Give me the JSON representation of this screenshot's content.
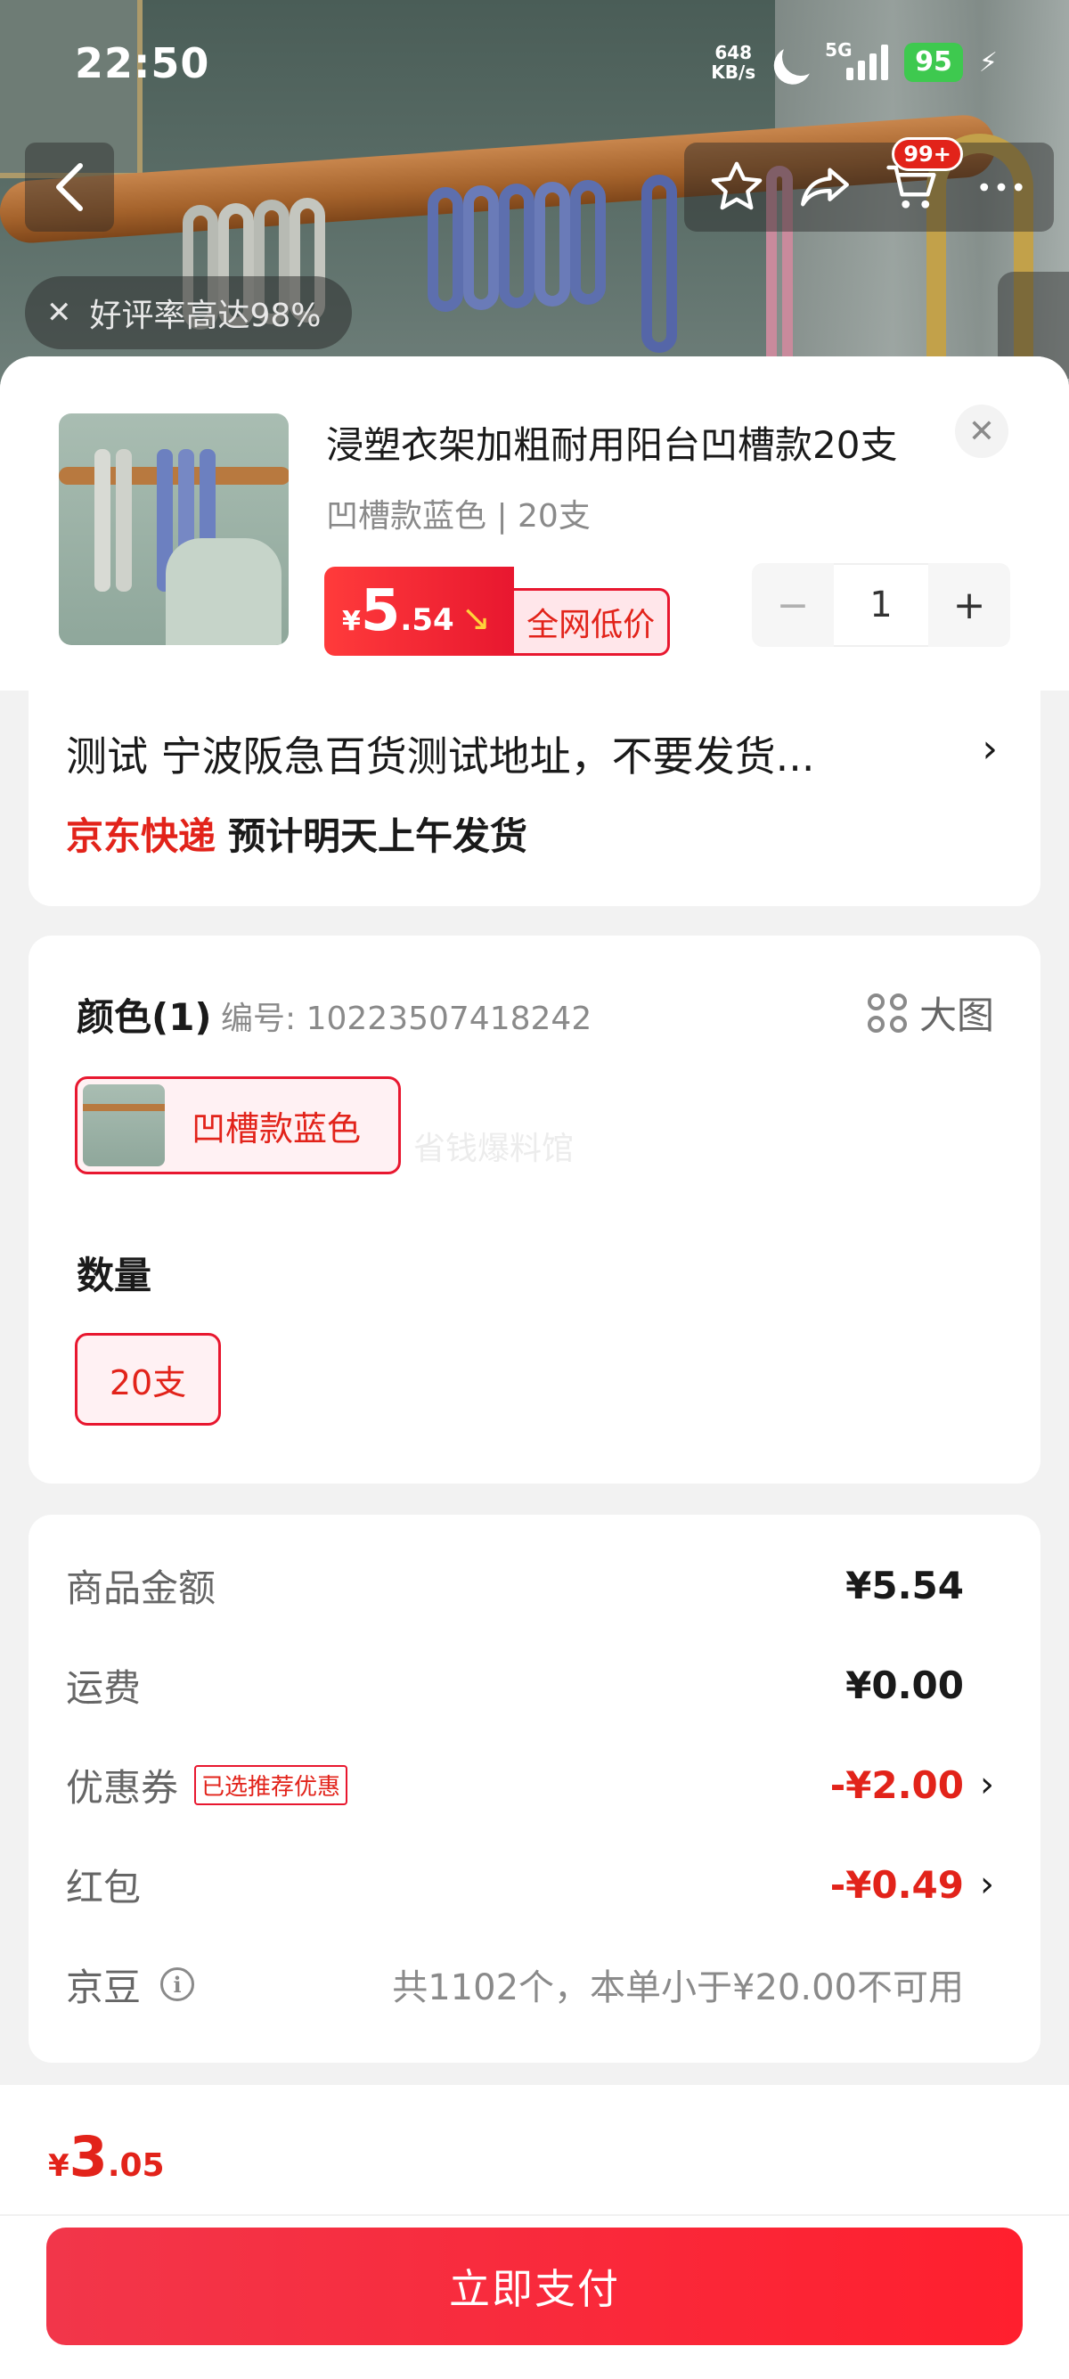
{
  "status_bar": {
    "time": "22:50",
    "net_speed_value": "648",
    "net_speed_unit": "KB/s",
    "network": "5G",
    "battery": "95"
  },
  "nav": {
    "cart_badge": "99+"
  },
  "rating_chip": {
    "text": "好评率高达98%"
  },
  "product": {
    "title": "浸塑衣架加粗耐用阳台凹槽款20支",
    "spec": "凹槽款蓝色 | 20支",
    "price_currency": "¥",
    "price_int": "5",
    "price_dec": ".54",
    "price_label": "全网低价",
    "quantity": "1"
  },
  "address": {
    "text": "测试  宁波阪急百货测试地址，不要发货...",
    "carrier": "京东快递",
    "eta": "预计明天上午发货"
  },
  "spec_panel": {
    "color_title": "颜色(1)",
    "sku": "编号: 10223507418242",
    "big_image": "大图",
    "color_option": "凹槽款蓝色",
    "watermark": "省钱爆料馆",
    "quantity_title": "数量",
    "quantity_option": "20支"
  },
  "costs": {
    "goods_label": "商品金额",
    "goods_value": "¥5.54",
    "shipping_label": "运费",
    "shipping_value": "¥0.00",
    "coupon_label": "优惠券",
    "coupon_tag": "已选推荐优惠",
    "coupon_value": "-¥2.00",
    "redpacket_label": "红包",
    "redpacket_value": "-¥0.49",
    "beans_label": "京豆",
    "beans_note": "共1102个，本单小于¥20.00不可用"
  },
  "footer": {
    "total_currency": "¥",
    "total_int": "3",
    "total_dec": ".05",
    "pay_label": "立即支付"
  },
  "colors": {
    "accent_red": "#e2231a",
    "pay_button": "#ff1f2e",
    "battery_green": "#3ec94f"
  }
}
